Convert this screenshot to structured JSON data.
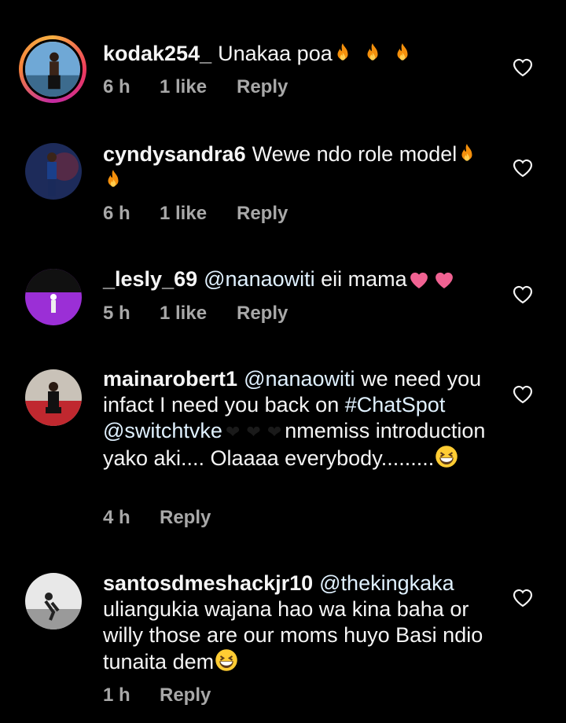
{
  "comments": [
    {
      "username": "kodak254_",
      "text": "Unakaa poa",
      "emoji": [
        "fire",
        "fire",
        "fire"
      ],
      "time": "6 h",
      "likes": "1 like",
      "reply": "Reply"
    },
    {
      "username": "cyndysandra6",
      "text": "Wewe ndo role model",
      "emoji": [
        "fire",
        "fire"
      ],
      "time": "6 h",
      "likes": "1 like",
      "reply": "Reply"
    },
    {
      "username": "_lesly_69",
      "mention": "@nanaowiti",
      "text": "eii mama",
      "emoji": [
        "pink-heart",
        "pink-heart"
      ],
      "time": "5 h",
      "likes": "1 like",
      "reply": "Reply"
    },
    {
      "username": "mainarobert1",
      "mention": "@nanaowiti",
      "text_part1": "we need you infact I need you back on",
      "hashtag": "#ChatSpot",
      "mention2": "@switchtvke",
      "text_part2": "nmemiss introduction yako aki.... Olaaaa everybody.........",
      "emoji": [
        "black-heart",
        "black-heart",
        "black-heart",
        "grinning-squint-face"
      ],
      "time": "4 h",
      "reply": "Reply"
    },
    {
      "username": "santosdmeshackjr10",
      "mention": "@thekingkaka",
      "text": "uliangukia wajana hao wa kina baha or willy those are our moms huyo Basi ndio tunaita dem",
      "emoji": [
        "grinning-squint-face"
      ],
      "time": "1 h",
      "reply": "Reply"
    }
  ],
  "colors": {
    "background": "#000000",
    "text": "#f5f5f5",
    "meta": "#a8a8a8",
    "mention": "#e0f1ff"
  }
}
